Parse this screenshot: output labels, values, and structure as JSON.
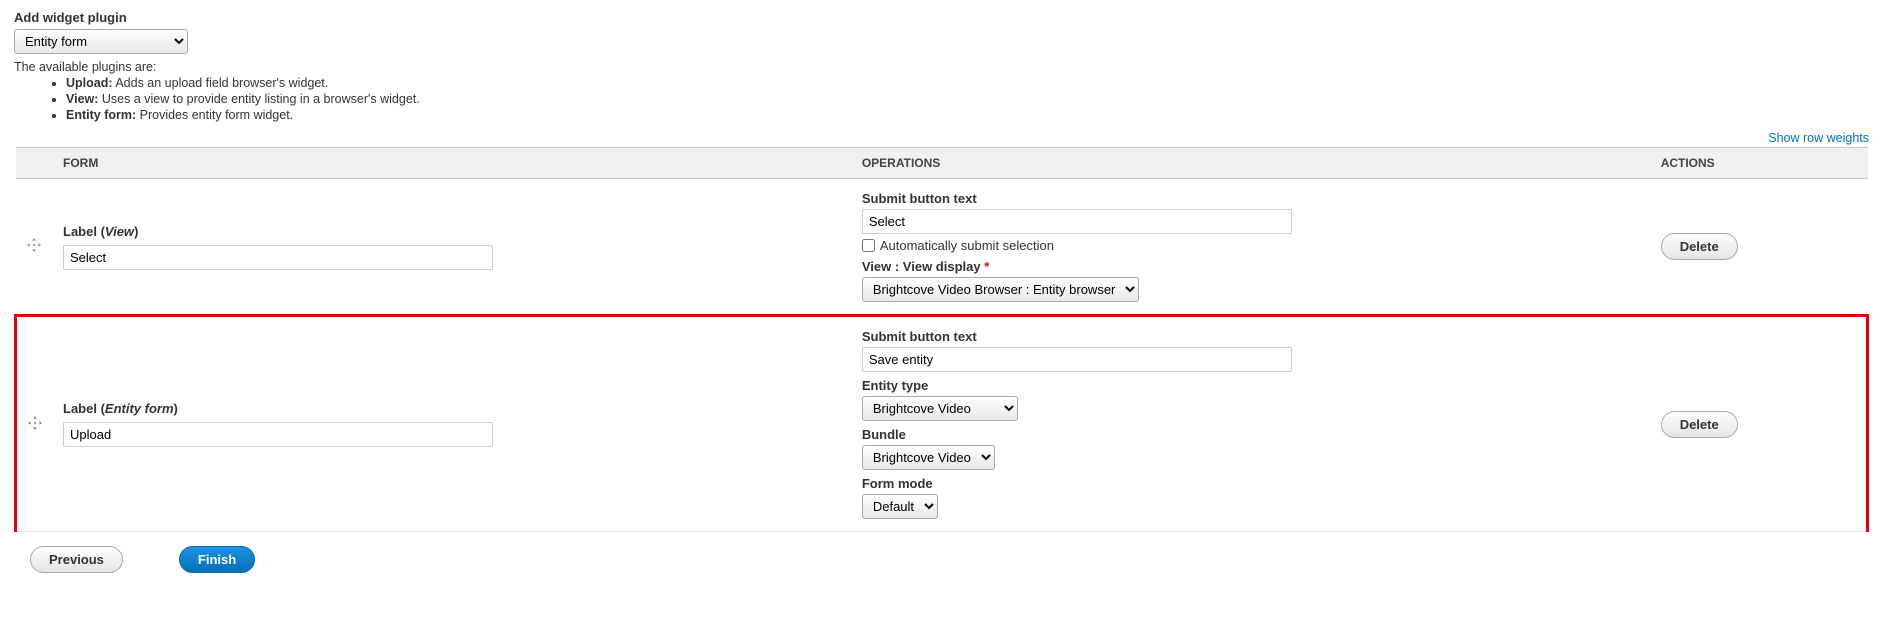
{
  "top": {
    "add_widget_label": "Add widget plugin",
    "plugin_select_value": "Entity form",
    "helper_text": "The available plugins are:",
    "plugins": [
      {
        "name": "Upload:",
        "desc": "Adds an upload field browser's widget."
      },
      {
        "name": "View:",
        "desc": "Uses a view to provide entity listing in a browser's widget."
      },
      {
        "name": "Entity form:",
        "desc": "Provides entity form widget."
      }
    ]
  },
  "show_weights_link": "Show row weights",
  "table": {
    "headers": {
      "form": "FORM",
      "operations": "OPERATIONS",
      "actions": "ACTIONS"
    }
  },
  "rows": [
    {
      "label_prefix": "Label (",
      "label_type": "View",
      "label_suffix": ")",
      "label_value": "Select",
      "submit_label": "Submit button text",
      "submit_value": "Select",
      "auto_submit_label": "Automatically submit selection",
      "view_display_label": "View : View display",
      "view_display_value": "Brightcove Video Browser : Entity browser",
      "delete_label": "Delete"
    },
    {
      "label_prefix": "Label (",
      "label_type": "Entity form",
      "label_suffix": ")",
      "label_value": "Upload",
      "submit_label": "Submit button text",
      "submit_value": "Save entity",
      "entity_type_label": "Entity type",
      "entity_type_value": "Brightcove Video",
      "bundle_label": "Bundle",
      "bundle_value": "Brightcove Video",
      "form_mode_label": "Form mode",
      "form_mode_value": "Default",
      "delete_label": "Delete"
    }
  ],
  "footer": {
    "previous": "Previous",
    "finish": "Finish"
  }
}
